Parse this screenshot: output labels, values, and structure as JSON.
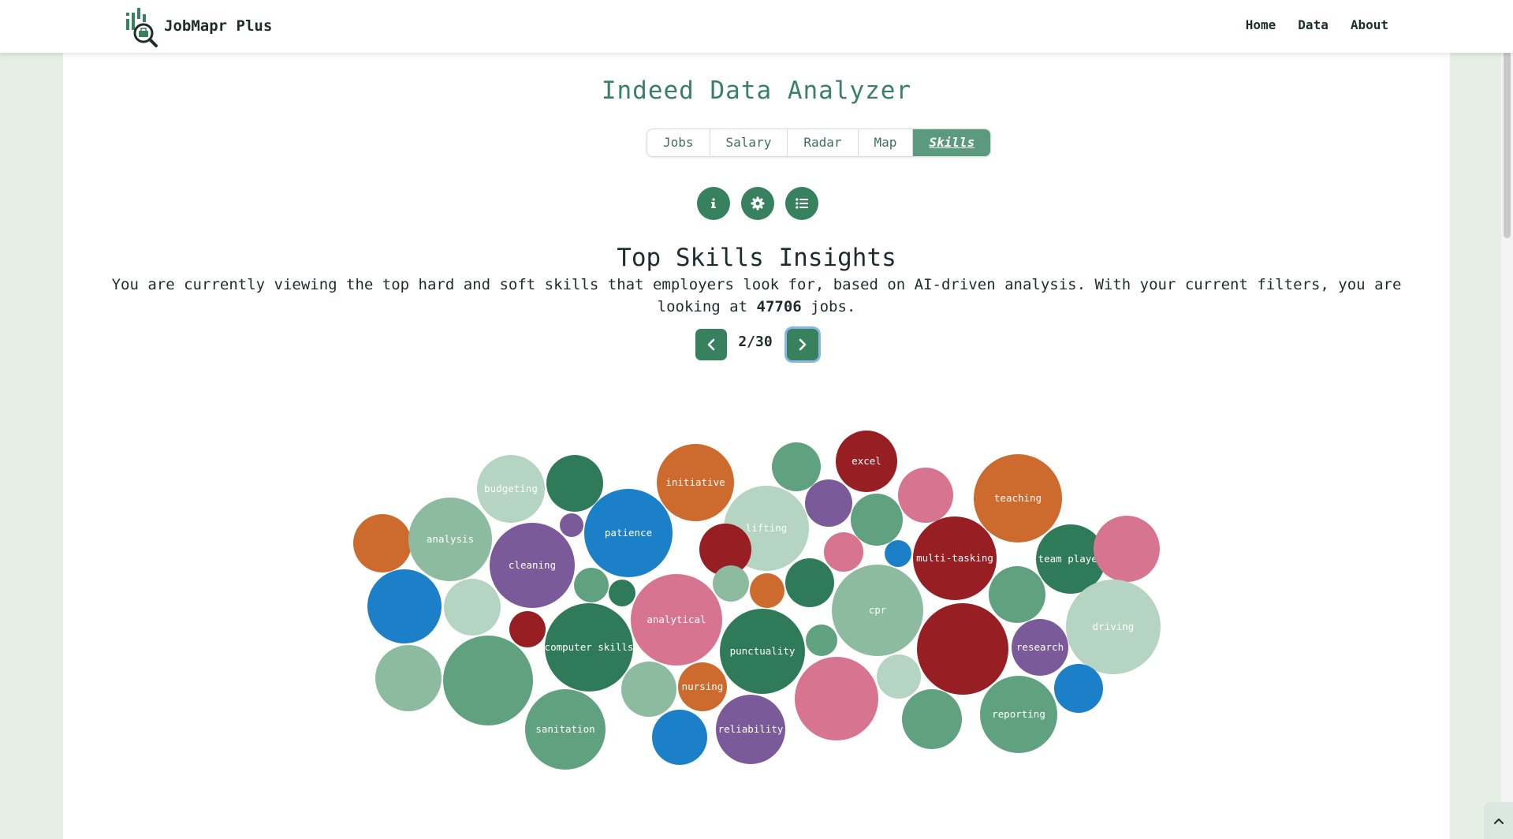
{
  "brand": {
    "name": "JobMapr Plus"
  },
  "nav": {
    "items": [
      "Home",
      "Data",
      "About"
    ]
  },
  "page": {
    "title": "Indeed Data Analyzer"
  },
  "tabs": [
    {
      "label": "Jobs",
      "active": false
    },
    {
      "label": "Salary",
      "active": false
    },
    {
      "label": "Radar",
      "active": false
    },
    {
      "label": "Map",
      "active": false
    },
    {
      "label": "Skills",
      "active": true
    }
  ],
  "toolbar": {
    "icons": [
      "info-icon",
      "gear-icon",
      "list-icon"
    ]
  },
  "skills": {
    "title": "Top Skills Insights",
    "desc_before": "You are currently viewing the top hard and soft skills that employers look for, based on AI-driven analysis. With your current filters, you are looking at ",
    "job_count": "47706",
    "desc_after": " jobs."
  },
  "pager": {
    "label": "2/30"
  },
  "colors": {
    "accent": "#37815f",
    "purple": "#7b5a9a",
    "blue": "#1c80c8",
    "orange": "#cd6b2e",
    "red": "#971e22",
    "pink": "#d77591",
    "light": "#b5d4c1",
    "mid": "#8cbba0",
    "teal": "#60a280",
    "dark": "#2f7b59"
  },
  "bubbles": [
    {
      "label": "budgeting",
      "color": "light"
    },
    {
      "label": "",
      "color": "dark"
    },
    {
      "label": "initiative",
      "color": "orange"
    },
    {
      "label": "",
      "color": "teal"
    },
    {
      "label": "excel",
      "color": "red"
    },
    {
      "label": "",
      "color": "pink"
    },
    {
      "label": "teaching",
      "color": "orange"
    },
    {
      "label": "",
      "color": "orange"
    },
    {
      "label": "analysis",
      "color": "mid"
    },
    {
      "label": "",
      "color": "purple"
    },
    {
      "label": "cleaning",
      "color": "purple"
    },
    {
      "label": "patience",
      "color": "blue"
    },
    {
      "label": "lifting",
      "color": "light"
    },
    {
      "label": "",
      "color": "purple"
    },
    {
      "label": "",
      "color": "teal"
    },
    {
      "label": "",
      "color": "red"
    },
    {
      "label": "",
      "color": "pink"
    },
    {
      "label": "",
      "color": "blue"
    },
    {
      "label": "multi-tasking",
      "color": "red"
    },
    {
      "label": "team player",
      "color": "dark"
    },
    {
      "label": "",
      "color": "pink"
    },
    {
      "label": "",
      "color": "blue"
    },
    {
      "label": "",
      "color": "light"
    },
    {
      "label": "",
      "color": "teal"
    },
    {
      "label": "",
      "color": "dark"
    },
    {
      "label": "",
      "color": "mid"
    },
    {
      "label": "",
      "color": "orange"
    },
    {
      "label": "",
      "color": "dark"
    },
    {
      "label": "cpr",
      "color": "mid"
    },
    {
      "label": "",
      "color": "teal"
    },
    {
      "label": "driving",
      "color": "light"
    },
    {
      "label": "",
      "color": "red"
    },
    {
      "label": "analytical",
      "color": "pink"
    },
    {
      "label": "computer skills",
      "color": "dark"
    },
    {
      "label": "punctuality",
      "color": "dark"
    },
    {
      "label": "",
      "color": "teal"
    },
    {
      "label": "",
      "color": "red"
    },
    {
      "label": "research",
      "color": "purple"
    },
    {
      "label": "",
      "color": "mid"
    },
    {
      "label": "",
      "color": "teal"
    },
    {
      "label": "",
      "color": "mid"
    },
    {
      "label": "nursing",
      "color": "orange"
    },
    {
      "label": "",
      "color": "pink"
    },
    {
      "label": "",
      "color": "light"
    },
    {
      "label": "",
      "color": "blue"
    },
    {
      "label": "sanitation",
      "color": "teal"
    },
    {
      "label": "",
      "color": "blue"
    },
    {
      "label": "reliability",
      "color": "purple"
    },
    {
      "label": "",
      "color": "teal"
    },
    {
      "label": "reporting",
      "color": "teal"
    }
  ]
}
